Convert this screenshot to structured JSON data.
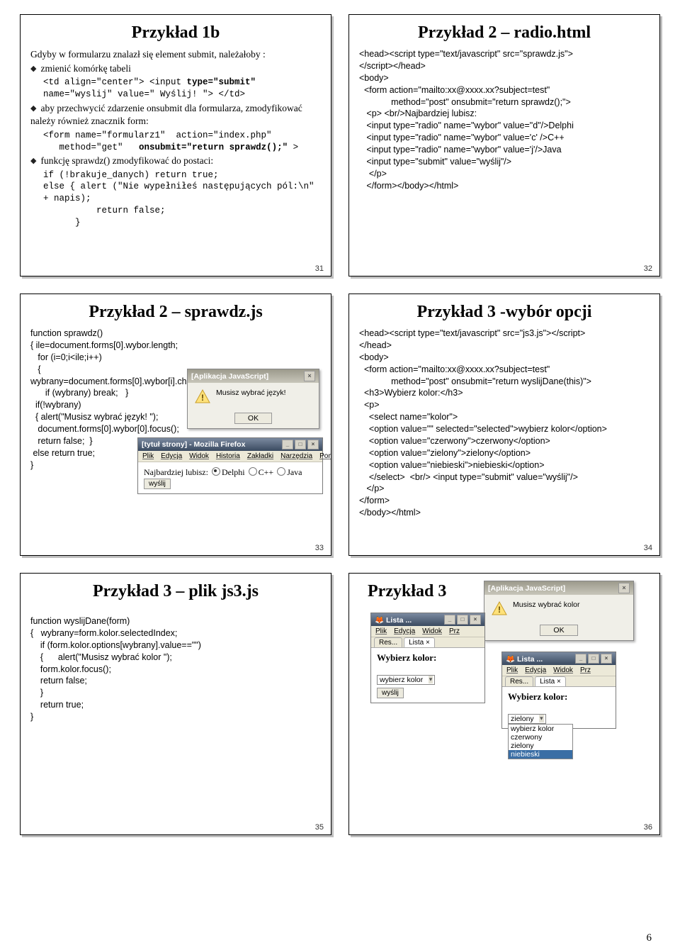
{
  "pagenum": "6",
  "slides": {
    "s31": {
      "title": "Przykład 1b",
      "lead": "Gdyby w formularzu znalazł się element submit, należałoby :",
      "b1": "zmienić komórkę tabeli",
      "c1a": "<td align=\"center\"> <input ",
      "c1b": "type=\"submit\"",
      "c1c": " name=\"wyslij\"  value=\"   Wyślij!    \"> </td>",
      "b2": "aby przechwycić zdarzenie onsubmit dla formularza, zmodyfikować należy również znacznik form:",
      "c2a": "<form name=\"formularz1\"  action=\"index.php\"\n   method=\"get\"   ",
      "c2b": "onsubmit=\"return sprawdz();\"",
      "c2c": " >",
      "b3": "funkcję sprawdz() zmodyfikować do postaci:",
      "c3": "if (!brakuje_danych) return true;\nelse { alert (\"Nie wypełniłeś następujących pól:\\n\" + napis);\n          return false;\n      }",
      "num": "31"
    },
    "s32": {
      "title": "Przykład 2 – radio.html",
      "code": "<head><script type=\"text/javascript\" src=\"sprawdz.js\">\n</script></head>\n<body>\n  <form action=\"mailto:xx@xxxx.xx?subject=test\"\n             method=\"post\" onsubmit=\"return sprawdz();\">\n   <p> <br/>Najbardziej lubisz:\n   <input type=\"radio\" name=\"wybor\" value=\"d\"/>Delphi\n   <input type=\"radio\" name=\"wybor\" value='c' />C++\n   <input type=\"radio\" name=\"wybor\" value='j'/>Java\n   <input type=\"submit\" value=\"wyślij\"/>\n    </p>\n   </form></body></html>",
      "num": "32"
    },
    "s33": {
      "title": "Przykład 2 – sprawdz.js",
      "code": "function sprawdz()\n{ ile=document.forms[0].wybor.length;\n   for (i=0;i<ile;i++)\n   { wybrany=document.forms[0].wybor[i].checked;\n      if (wybrany) break;   }\n  if(!wybrany)\n  { alert(\"Musisz wybrać język! \");\n   document.forms[0].wybor[0].focus();\n   return false;  }\n else return true;\n}",
      "num": "33",
      "dlg_title": "[Aplikacja JavaScript]",
      "dlg_msg": "Musisz wybrać język!",
      "dlg_ok": "OK",
      "ff_title": "[tytuł strony] - Mozilla Firefox",
      "menu": [
        "Plik",
        "Edycja",
        "Widok",
        "Historia",
        "Zakładki",
        "Narzędzia",
        "Pomoc"
      ],
      "ff_text": "Najbardziej lubisz:",
      "opts": [
        "Delphi",
        "C++",
        "Java"
      ],
      "submit": "wyślij"
    },
    "s34": {
      "title": "Przykład 3 -wybór opcji",
      "code": "<head><script type=\"text/javascript\" src=\"js3.js\"></script>\n</head>\n<body>\n  <form action=\"mailto:xx@xxxx.xx?subject=test\"\n             method=\"post\" onsubmit=\"return wyslijDane(this)\">\n  <h3>Wybierz kolor:</h3>\n  <p>\n    <select name=\"kolor\">\n    <option value=\"\" selected=\"selected\">wybierz kolor</option>\n    <option value=\"czerwony\">czerwony</option>\n    <option value=\"zielony\">zielony</option>\n    <option value=\"niebieski\">niebieski</option>\n    </select>  <br/> <input type=\"submit\" value=\"wyślij\"/>\n   </p>\n</form>\n</body></html>",
      "num": "34"
    },
    "s35": {
      "title": "Przykład 3 – plik js3.js",
      "code": "function wyslijDane(form)\n{   wybrany=form.kolor.selectedIndex;\n    if (form.kolor.options[wybrany].value==\"\")\n    {      alert(\"Musisz wybrać kolor \");\n    form.kolor.focus();\n    return false;\n    }\n    return true;\n}",
      "num": "35"
    },
    "s36": {
      "title": "Przykład 3",
      "num": "36",
      "dlg_title": "[Aplikacja JavaScript]",
      "dlg_msg": "Musisz wybrać kolor",
      "dlg_ok": "OK",
      "win1_title": "Lista ...",
      "menu": [
        "Plik",
        "Edycja",
        "Widok",
        "Prz"
      ],
      "tabs": [
        "Res...",
        "Lista"
      ],
      "h3": "Wybierz kolor:",
      "sel": "wybierz kolor",
      "submit": "wyślij",
      "sel2": "zielony",
      "listitems": [
        "wybierz kolor",
        "czerwony",
        "zielony",
        "niebieski"
      ]
    }
  }
}
